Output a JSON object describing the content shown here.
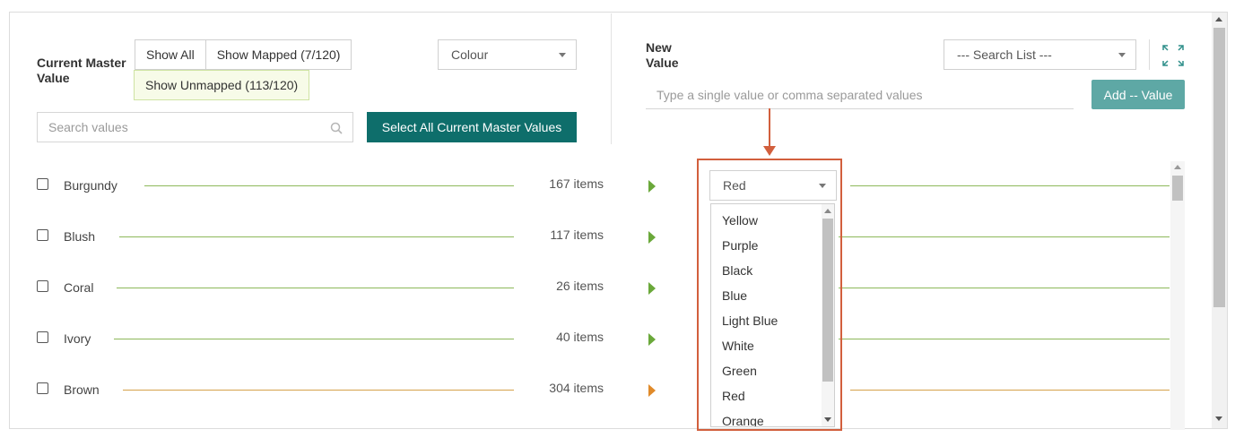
{
  "left_panel": {
    "title": "Current Master Value",
    "filters": {
      "show_all": "Show All",
      "show_mapped": "Show Mapped (7/120)",
      "show_unmapped": "Show Unmapped (113/120)"
    },
    "attribute_select": {
      "value": "Colour"
    },
    "search": {
      "placeholder": "Search values"
    },
    "select_all_label": "Select All Current Master Values"
  },
  "right_panel": {
    "title": "New Value",
    "search_list": {
      "value": "--- Search List ---"
    },
    "value_input": {
      "placeholder": "Type a single value or comma separated values"
    },
    "add_label": "Add -- Value",
    "selected_value": "Red",
    "dropdown_options": [
      "Yellow",
      "Purple",
      "Black",
      "Blue",
      "Light Blue",
      "White",
      "Green",
      "Red",
      "Orange"
    ]
  },
  "rows": [
    {
      "name": "Burgundy",
      "count": "167 items",
      "mapped": true
    },
    {
      "name": "Blush",
      "count": "117 items",
      "mapped": true
    },
    {
      "name": "Coral",
      "count": "26 items",
      "mapped": true
    },
    {
      "name": "Ivory",
      "count": "40 items",
      "mapped": true
    },
    {
      "name": "Brown",
      "count": "304 items",
      "mapped": false
    }
  ],
  "colors": {
    "primary": "#0e6e6b",
    "primary_light": "#5ea8a5",
    "mapped_line": "#8db85a",
    "unmapped_line": "#d6a24a",
    "mapped_arrow": "#6aa83a",
    "unmapped_arrow": "#e08a2a",
    "callout": "#d25f3d"
  }
}
